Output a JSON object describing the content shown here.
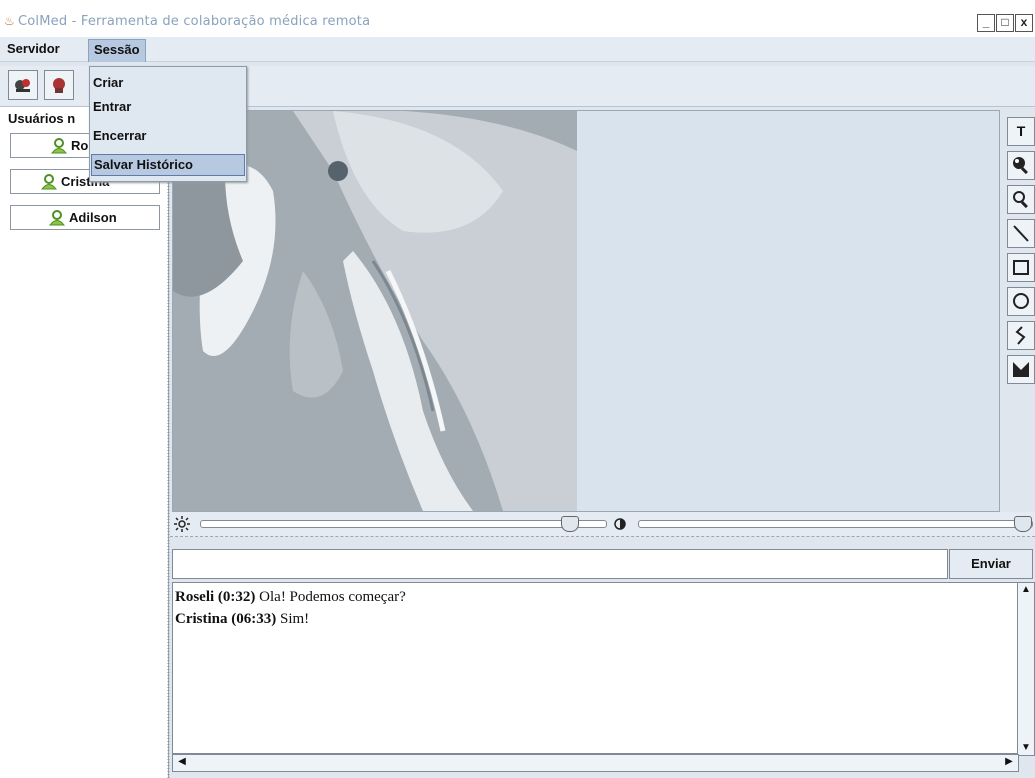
{
  "window": {
    "title": "ColMed - Ferramenta de colaboração médica remota",
    "buttons": [
      "_",
      "□",
      "x"
    ]
  },
  "menubar": {
    "items": [
      "Servidor",
      "Sessão"
    ],
    "active": "Sessão"
  },
  "session_menu": {
    "items": [
      "Criar",
      "Entrar",
      "Encerrar",
      "Salvar Histórico"
    ],
    "selected": "Salvar Histórico"
  },
  "users": {
    "label": "Usuários n",
    "list": [
      "Ro",
      "Cristina",
      "Adilson"
    ]
  },
  "viewer_tools": {
    "text_tool": "T"
  },
  "chat": {
    "input_value": "",
    "send_label": "Enviar",
    "messages": [
      {
        "sender": "Roseli (0:32)",
        "text": " Ola! Podemos começar?"
      },
      {
        "sender": "Cristina (06:33)",
        "text": " Sim!"
      }
    ]
  },
  "sliders": {
    "brightness_level": 0.93,
    "contrast_level": 1.0
  },
  "colors": {
    "accent_selected": "#b7c9e0",
    "user_icon": "#5fa02f"
  }
}
